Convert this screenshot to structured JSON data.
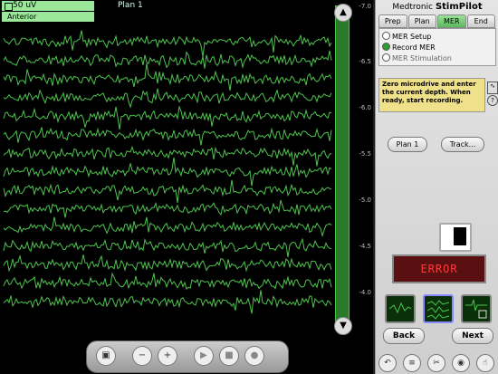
{
  "scope": {
    "top_label": "50 uV",
    "plan_label": "Plan 1",
    "direction_label": "Anterior",
    "depth_ticks": [
      "-7.0",
      "-6.5",
      "-6.0",
      "-5.5",
      "-5.0",
      "-4.5",
      "-4.0"
    ],
    "trace_color": "#4ec34e"
  },
  "brand": {
    "company": "Medtronic",
    "product": "StimPilot"
  },
  "tabs": [
    {
      "label": "Prep"
    },
    {
      "label": "Plan"
    },
    {
      "label": "MER"
    },
    {
      "label": "End"
    }
  ],
  "mer_options": [
    {
      "label": "MER Setup",
      "selected": false
    },
    {
      "label": "Record MER",
      "selected": true
    },
    {
      "label": "MER Stimulation",
      "selected": false
    }
  ],
  "instructions": "Zero microdrive and enter the current depth.  When ready, start recording.",
  "buttons": {
    "plan": "Plan 1",
    "track": "Track...",
    "back": "Back",
    "next": "Next"
  },
  "status": {
    "error_text": "ERROR",
    "error_color": "#ff3a3a"
  }
}
